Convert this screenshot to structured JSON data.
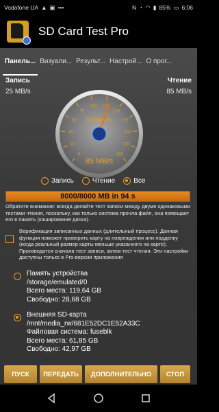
{
  "status": {
    "carrier": "Vodafone UA",
    "battery": "85%",
    "time": "6:06"
  },
  "app": {
    "title": "SD Card Test Pro"
  },
  "tabs": [
    {
      "label": "Панель..."
    },
    {
      "label": "Визуали..."
    },
    {
      "label": "Результ..."
    },
    {
      "label": "Настрой..."
    },
    {
      "label": "О прог..."
    }
  ],
  "write": {
    "label": "Запись",
    "value": "25 MB/s"
  },
  "read": {
    "label": "Чтение",
    "value": "85 MB/s"
  },
  "gauge": {
    "label": "Скорость",
    "value_text": "85 MB/s",
    "value": 85,
    "max": 150,
    "ticks": [
      "0",
      "10",
      "25",
      "50",
      "75",
      "100",
      "125",
      "150",
      "175",
      "100",
      "125",
      "150"
    ]
  },
  "mode": {
    "options": [
      "Запись",
      "Чтение",
      "Все"
    ],
    "selected": "Все"
  },
  "progress": {
    "text": "8000/8000 MB in 94 s",
    "fraction": 1.0
  },
  "note": "Обратите внимание: всегда делайте тест записи между двумя одинаковыми тестами чтения, поскольку, как только система прочла файл, она помещает его в память (кэширование диска).",
  "verify": "Верификация записанных данных (длительный процесс). Данная функция поможет проверить карту на повреждения или подделку (когда реальный размер карты меньше указанного на карте). Производится сначала тест записи, затем тест чтения. Эти настройки доступны только в Pro-версии приложения",
  "storage": [
    {
      "title": "Память устройства",
      "path": "/storage/emulated/0",
      "total": "Всего места: 119,64 GB",
      "free": "Свободно: 28,68 GB",
      "fs": "",
      "selected": false
    },
    {
      "title": "Внешняя SD-карта",
      "path": "/mnt/media_rw/681E52DC1E52A33C",
      "fs": "Файловая система: fuseblk",
      "total": "Всего места: 61,85 GB",
      "free": "Свободно: 42,97 GB",
      "selected": true
    }
  ],
  "buttons": {
    "start": "ПУСК",
    "share": "ПЕРЕДАТЬ",
    "more": "ДОПОЛНИТЕЛЬНО",
    "stop": "СТОП"
  },
  "colors": {
    "accent": "#e8a020",
    "button": "#c89840",
    "progress": "#e08018"
  }
}
